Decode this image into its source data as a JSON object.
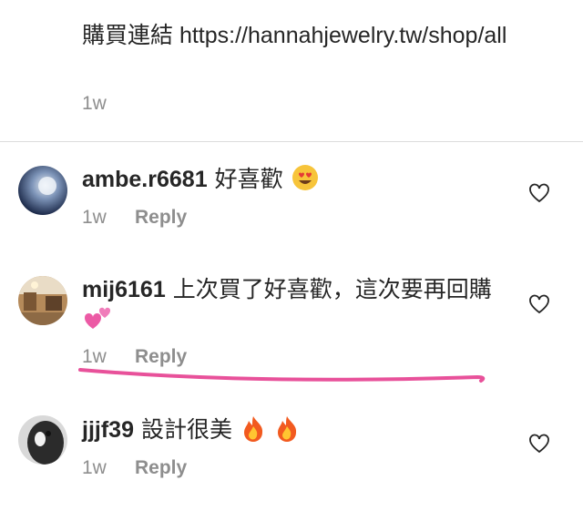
{
  "post": {
    "caption": "購買連結 https://hannahjewelry.tw/shop/all",
    "time": "1w"
  },
  "comments": [
    {
      "username": "ambe.r6681",
      "text": "好喜歡",
      "emoji": "heart-eyes-emoji",
      "time": "1w",
      "reply_label": "Reply"
    },
    {
      "username": "mij6161",
      "text": "上次買了好喜歡，這次要再回購",
      "emoji": "two-hearts-emoji",
      "time": "1w",
      "reply_label": "Reply"
    },
    {
      "username": "jjjf39",
      "text": "設計很美",
      "emoji": "fire-emoji",
      "time": "1w",
      "reply_label": "Reply"
    }
  ],
  "colors": {
    "text": "#262626",
    "secondary": "#8e8e8e",
    "divider": "#dbdbdb",
    "highlight_underline": "#e8519a"
  }
}
